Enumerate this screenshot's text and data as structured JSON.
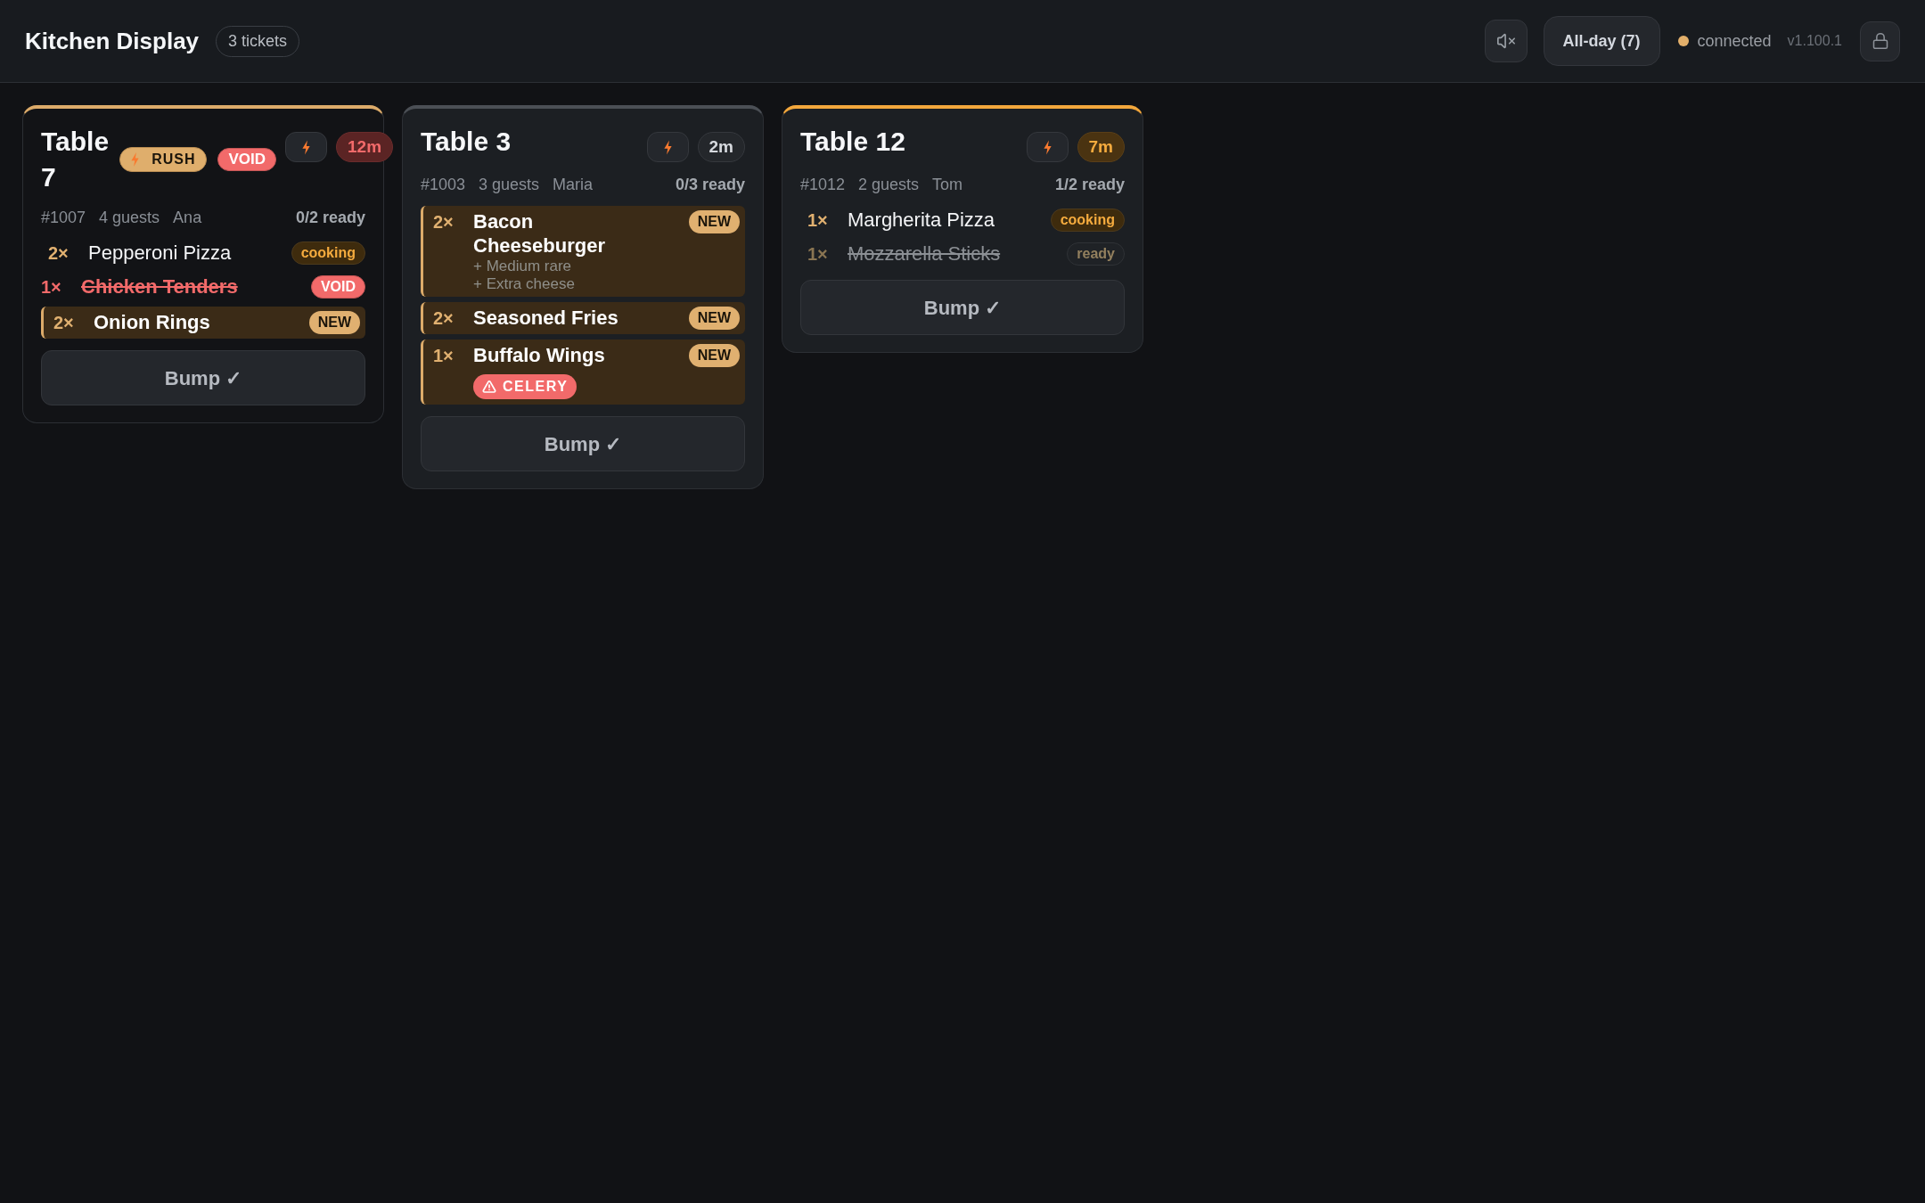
{
  "header": {
    "title": "Kitchen Display",
    "ticket_count": "3 tickets",
    "sound": {
      "muted": true
    },
    "all_day_button": "All-day (7)",
    "connection": {
      "label": "connected",
      "color": "#e3b06b"
    },
    "version": "v1.100.1"
  },
  "tickets": [
    {
      "title": "Table 7",
      "color": "#dcab6a",
      "rush": true,
      "badges": [
        {
          "kind": "rush",
          "label": "RUSH"
        },
        {
          "kind": "void",
          "label": "VOID"
        }
      ],
      "timer": {
        "kind": "late",
        "label": "12m"
      },
      "order_number": "#1007",
      "guests": "4 guests",
      "server": "Ana",
      "ready": "0/2 ready",
      "items": [
        {
          "kind": "cooking",
          "quantity": "2×",
          "name": "Pepperoni Pizza",
          "badge": "cooking"
        },
        {
          "kind": "void",
          "quantity": "1×",
          "name": "Chicken Tenders",
          "badge": "VOID"
        },
        {
          "kind": "new",
          "quantity": "2×",
          "name": "Onion Rings",
          "badge": "NEW"
        }
      ],
      "bump_button": "Bump ✓"
    },
    {
      "title": "Table 3",
      "color": "#4b4f55",
      "rush": false,
      "timer": {
        "kind": "normal",
        "label": "2m"
      },
      "order_number": "#1003",
      "guests": "3 guests",
      "server": "Maria",
      "ready": "0/3 ready",
      "items": [
        {
          "kind": "new",
          "quantity": "2×",
          "name": "Bacon Cheeseburger",
          "badge": "NEW",
          "modifiers": [
            "+ Medium rare",
            "+ Extra cheese"
          ]
        },
        {
          "kind": "new",
          "quantity": "2×",
          "name": "Seasoned Fries",
          "badge": "NEW"
        },
        {
          "kind": "new",
          "quantity": "1×",
          "name": "Buffalo Wings",
          "badge": "NEW",
          "allergens": [
            "CELERY"
          ]
        }
      ],
      "bump_button": "Bump ✓"
    },
    {
      "title": "Table 12",
      "color": "#f3a73c",
      "rush": false,
      "timer": {
        "kind": "warning",
        "label": "7m"
      },
      "order_number": "#1012",
      "guests": "2 guests",
      "server": "Tom",
      "ready": "1/2 ready",
      "items": [
        {
          "kind": "cooking",
          "quantity": "1×",
          "name": "Margherita Pizza",
          "badge": "cooking"
        },
        {
          "kind": "ready",
          "quantity": "1×",
          "name": "Mozzarella Sticks",
          "badge": "ready"
        }
      ],
      "bump_button": "Bump ✓"
    }
  ]
}
